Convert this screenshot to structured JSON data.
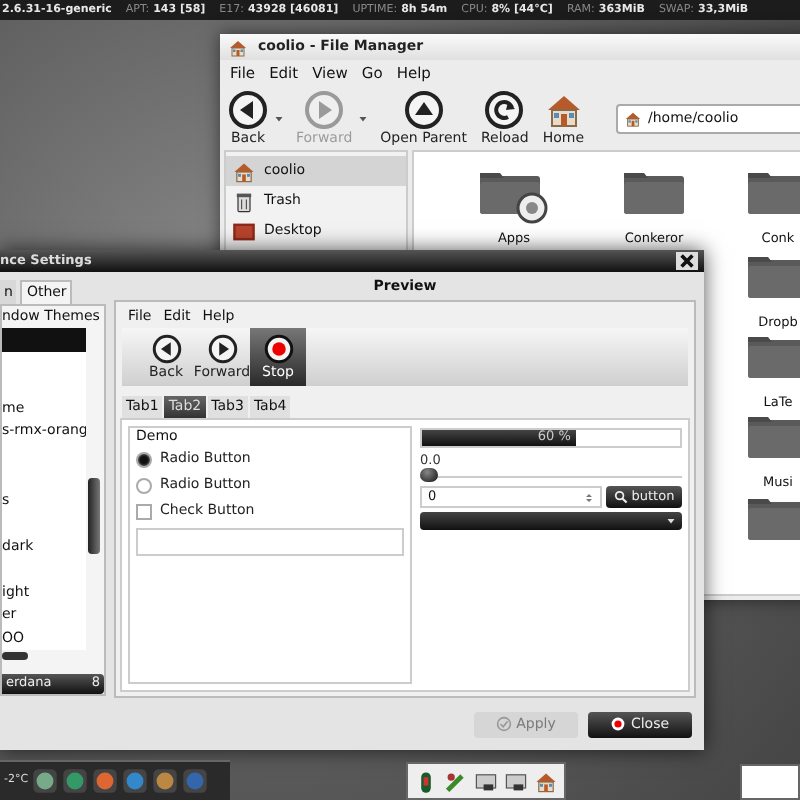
{
  "top_bar": {
    "items": [
      {
        "value": "2.6.31-16-generic"
      },
      {
        "label": "APT:",
        "value": "143 [58]"
      },
      {
        "label": "E17:",
        "value": "43928 [46081]"
      },
      {
        "label": "UPTIME:",
        "value": "8h 54m"
      },
      {
        "label": "CPU:",
        "value": "8% [44°C]"
      },
      {
        "label": "RAM:",
        "value": "363MiB"
      },
      {
        "label": "SWAP:",
        "value": "33,3MiB"
      }
    ]
  },
  "file_manager": {
    "title": "coolio - File Manager",
    "menu": [
      "File",
      "Edit",
      "View",
      "Go",
      "Help"
    ],
    "toolbar": [
      {
        "label": "Back",
        "kind": "back",
        "disabled": false,
        "dropdown": true
      },
      {
        "label": "Forward",
        "kind": "forward",
        "disabled": true,
        "dropdown": true
      },
      {
        "label": "Open Parent",
        "kind": "up",
        "disabled": false,
        "dropdown": false
      },
      {
        "label": "Reload",
        "kind": "reload",
        "disabled": false,
        "dropdown": false
      },
      {
        "label": "Home",
        "kind": "home",
        "disabled": false,
        "dropdown": false
      }
    ],
    "path": "/home/coolio",
    "sidebar": [
      {
        "label": "coolio",
        "kind": "home",
        "selected": true
      },
      {
        "label": "Trash",
        "kind": "trash",
        "selected": false
      },
      {
        "label": "Desktop",
        "kind": "desktop",
        "selected": false
      }
    ],
    "folders": [
      {
        "label": "Apps",
        "kind": "badged"
      },
      {
        "label": "Conkeror",
        "kind": "plain"
      },
      {
        "label": "Conk",
        "kind": "plain"
      }
    ],
    "right_column": [
      {
        "label": "Dropb",
        "kind": "plain"
      },
      {
        "label": "LaTe",
        "kind": "plain"
      },
      {
        "label": "Musi",
        "kind": "plain"
      },
      {
        "kind": "plain"
      }
    ]
  },
  "appearance_settings": {
    "title": "nce Settings",
    "tabs": [
      {
        "label": "n",
        "selected": false
      },
      {
        "label": "Other",
        "selected": true
      }
    ],
    "theme_list": {
      "header": "ndow Themes",
      "items": [
        {
          "selected": true
        },
        {
          "selected": false
        },
        {
          "selected": false
        },
        {
          "label": "me",
          "selected": false
        },
        {
          "label": "s-rmx-orang",
          "selected": false
        },
        {
          "selected": false
        },
        {
          "selected": false
        },
        {
          "label": "s",
          "selected": false
        },
        {
          "selected": false
        },
        {
          "label": "dark",
          "selected": false
        },
        {
          "selected": false
        },
        {
          "label": "ight",
          "selected": false
        },
        {
          "label": "er",
          "selected": false
        },
        {
          "label": "OO",
          "selected": false
        }
      ]
    },
    "font_button": {
      "name": "erdana",
      "size": "8"
    },
    "preview": {
      "title": "Preview",
      "menu": [
        "File",
        "Edit",
        "Help"
      ],
      "toolbar": [
        {
          "label": "Back",
          "kind": "back",
          "selected": false
        },
        {
          "label": "Forward",
          "kind": "forward",
          "selected": false
        },
        {
          "label": "Stop",
          "kind": "stop",
          "selected": true
        }
      ],
      "tabs": [
        {
          "label": "Tab1",
          "selected": false
        },
        {
          "label": "Tab2",
          "selected": true
        },
        {
          "label": "Tab3",
          "selected": false
        },
        {
          "label": "Tab4",
          "selected": false
        }
      ],
      "frame_title": "Demo",
      "options": [
        {
          "kind": "radio",
          "label": "Radio Button",
          "checked": true
        },
        {
          "kind": "radio",
          "label": "Radio Button",
          "checked": false
        },
        {
          "kind": "check",
          "label": "Check Button",
          "checked": false
        }
      ],
      "progress": {
        "level": 0.6,
        "text": "60 %"
      },
      "scale": {
        "reading": "0.0",
        "level": 0
      },
      "spin_value": "0",
      "button": "button"
    },
    "buttons": [
      {
        "label": "Apply",
        "kind": "check",
        "disabled": true
      },
      {
        "label": "Close",
        "kind": "close",
        "disabled": false
      }
    ]
  },
  "taskbar": {
    "weather": "-2°C"
  }
}
